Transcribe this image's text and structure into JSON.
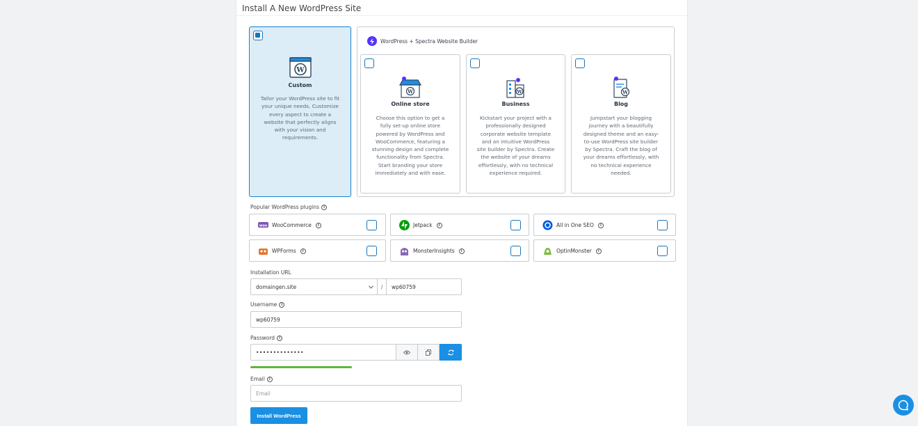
{
  "page": {
    "title": "Install A New WordPress Site"
  },
  "custom_card": {
    "title": "Custom",
    "description": "Tailor your WordPress site to fit your unique needs. Customize every aspect to create a website that perfectly aligns with your vision and requirements.",
    "selected": true
  },
  "builder": {
    "heading": "WordPress + Spectra Website Builder",
    "options": [
      {
        "title": "Online store",
        "description": "Choose this option to get a fully set-up online store powered by WordPress and WooCommerce, featuring a stunning design and complete functionality from Spectra. Start branding your store immediately and with ease."
      },
      {
        "title": "Business",
        "description": "Kickstart your project with a professionally designed corporate website template and an intuitive WordPress site builder by Spectra. Create the website of your dreams effortlessly, with no technical experience required."
      },
      {
        "title": "Blog",
        "description": "Jumpstart your blogging journey with a beautifully designed theme and an easy-to-use WordPress site builder by Spectra. Craft the blog of your dreams effortlessly, with no technical experience needed."
      }
    ]
  },
  "plugins": {
    "label": "Popular WordPress plugins",
    "items": [
      {
        "name": "WooCommerce",
        "icon": "woocommerce-icon"
      },
      {
        "name": "Jetpack",
        "icon": "jetpack-icon"
      },
      {
        "name": "All in One SEO",
        "icon": "aioseo-icon"
      },
      {
        "name": "WPForms",
        "icon": "wpforms-icon"
      },
      {
        "name": "MonsterInsights",
        "icon": "monsterinsights-icon"
      },
      {
        "name": "OptinMonster",
        "icon": "optinmonster-icon"
      }
    ]
  },
  "form": {
    "url_label": "Installation URL",
    "domain": "domaingen.site",
    "separator": "/",
    "path": "wp60759",
    "username_label": "Username",
    "username": "wp60759",
    "password_label": "Password",
    "password_masked": "••••••••••••••",
    "email_label": "Email",
    "email_placeholder": "Email",
    "install_label": "Install WordPress"
  },
  "colors": {
    "accent": "#1a8fe3",
    "selected_bg": "#dcedf8",
    "strength_bar": "#5eb63c",
    "spectra": "#5733ff"
  }
}
